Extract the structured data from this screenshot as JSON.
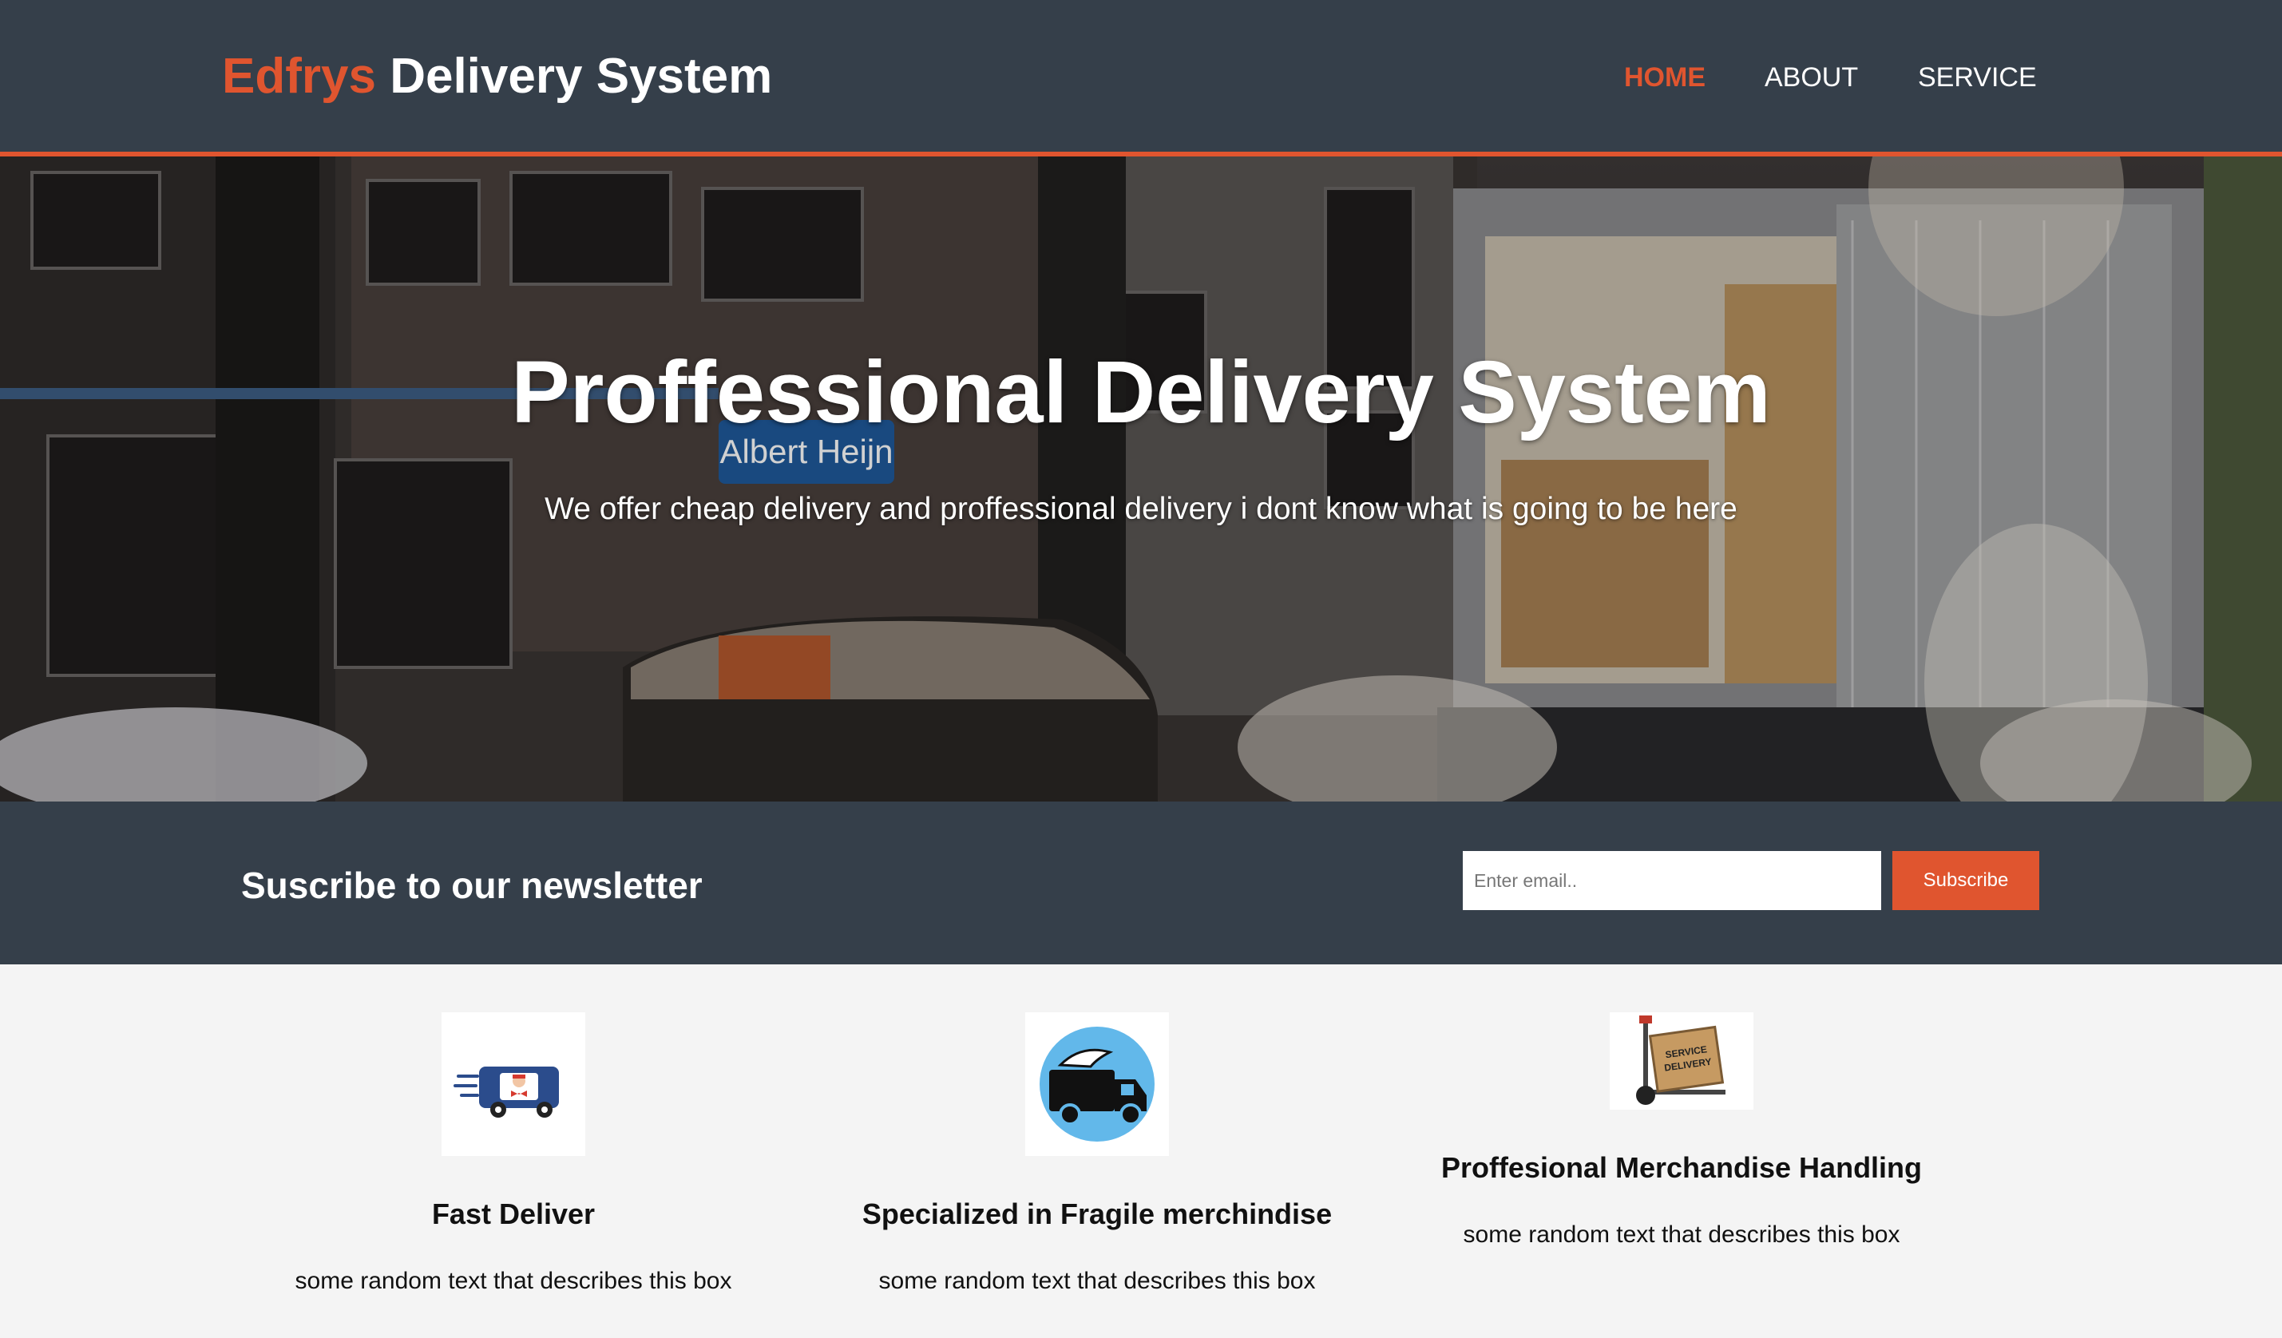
{
  "header": {
    "brand_accent": "Edfrys",
    "brand_rest": " Delivery System",
    "nav": {
      "home": "HOME",
      "about": "ABOUT",
      "service": "SERVICE"
    },
    "active_nav": "home"
  },
  "hero": {
    "title": "Proffessional Delivery System",
    "subtitle": "We offer cheap delivery and proffessional delivery i dont know what is going to be here",
    "background": "street-delivery-truck-photo"
  },
  "newsletter": {
    "title": "Suscribe to our newsletter",
    "email_placeholder": "Enter email..",
    "button_label": "Subscribe"
  },
  "features": [
    {
      "icon": "delivery-van-icon",
      "title": "Fast Deliver",
      "text": "some random text that describes this box"
    },
    {
      "icon": "winged-truck-icon",
      "title": "Specialized in Fragile merchindise",
      "text": "some random text that describes this box"
    },
    {
      "icon": "hand-truck-boxes-icon",
      "title": "Proffesional Merchandise Handling",
      "text": "some random text that describes this box"
    }
  ],
  "colors": {
    "accent": "#e0552f",
    "dark": "#353f4a",
    "light_bg": "#f4f4f4"
  }
}
